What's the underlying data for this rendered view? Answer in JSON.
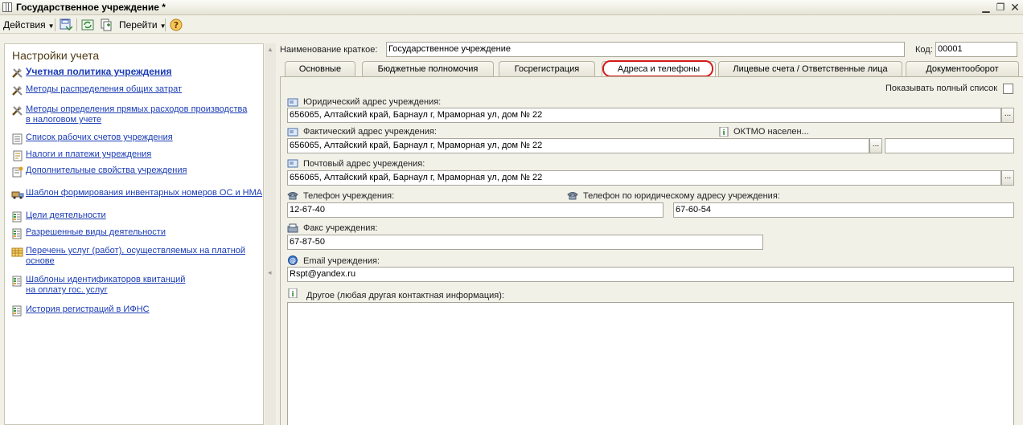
{
  "window": {
    "title": "Государственное учреждение *"
  },
  "toolbar": {
    "actions_label": "Действия",
    "goto_label": "Перейти"
  },
  "left_panel": {
    "title": "Настройки учета",
    "items": [
      {
        "label": "Учетная политика учреждения",
        "icon": "tools-icon",
        "bold": true
      },
      {
        "label": "Методы распределения общих затрат",
        "icon": "tools-icon"
      },
      {
        "label": "Методы определения прямых расходов производства в налоговом учете",
        "icon": "tools-icon"
      },
      {
        "label": "Список рабочих счетов учреждения",
        "icon": "list-icon"
      },
      {
        "label": "Налоги и платежи учреждения",
        "icon": "document-icon"
      },
      {
        "label": "Дополнительные свойства учреждения",
        "icon": "properties-icon"
      },
      {
        "label": "Шаблон формирования инвентарных номеров ОС и НМА",
        "icon": "truck-icon"
      },
      {
        "label": "Цели деятельности",
        "icon": "catalog-icon"
      },
      {
        "label": "Разрешенные виды деятельности",
        "icon": "catalog-icon"
      },
      {
        "label": "Перечень услуг (работ), осуществляемых на платной основе",
        "icon": "table-icon"
      },
      {
        "label": "Шаблоны идентификаторов квитанций на оплату гос. услуг",
        "icon": "catalog-icon"
      },
      {
        "label": "История регистраций в ИФНС",
        "icon": "catalog-icon"
      }
    ]
  },
  "header": {
    "short_name_label": "Наименование краткое:",
    "short_name_value": "Государственное учреждение",
    "code_label": "Код:",
    "code_value": "00001"
  },
  "tabs": [
    {
      "label": "Основные"
    },
    {
      "label": "Бюджетные полномочия"
    },
    {
      "label": "Госрегистрация"
    },
    {
      "label": "Адреса и телефоны",
      "active": true
    },
    {
      "label": "Лицевые счета / Ответственные лица"
    },
    {
      "label": "Документооборот"
    }
  ],
  "contacts": {
    "show_full_list_label": "Показывать полный список",
    "legal_address_label": "Юридический адрес учреждения:",
    "legal_address_value": "656065, Алтайский край, Барнаул г, Мраморная ул, дом № 22",
    "actual_address_label": "Фактический адрес учреждения:",
    "actual_address_value": "656065, Алтайский край, Барнаул г, Мраморная ул, дом № 22",
    "oktmo_label": "ОКТМО населен...",
    "oktmo_value": "",
    "postal_address_label": "Почтовый адрес учреждения:",
    "postal_address_value": "656065, Алтайский край, Барнаул г, Мраморная ул, дом № 22",
    "phone_label": "Телефон учреждения:",
    "phone_value": "12-67-40",
    "legal_phone_label": "Телефон по юридическому адресу учреждения:",
    "legal_phone_value": "67-60-54",
    "fax_label": "Факс учреждения:",
    "fax_value": "67-87-50",
    "email_label": "Email учреждения:",
    "email_value": "Rspt@yandex.ru",
    "other_label": "Другое (любая другая контактная информация):",
    "other_value": ""
  },
  "colors": {
    "link": "#1b3cb5",
    "highlight": "#d41c1c",
    "panel_title": "#4e3b15"
  }
}
